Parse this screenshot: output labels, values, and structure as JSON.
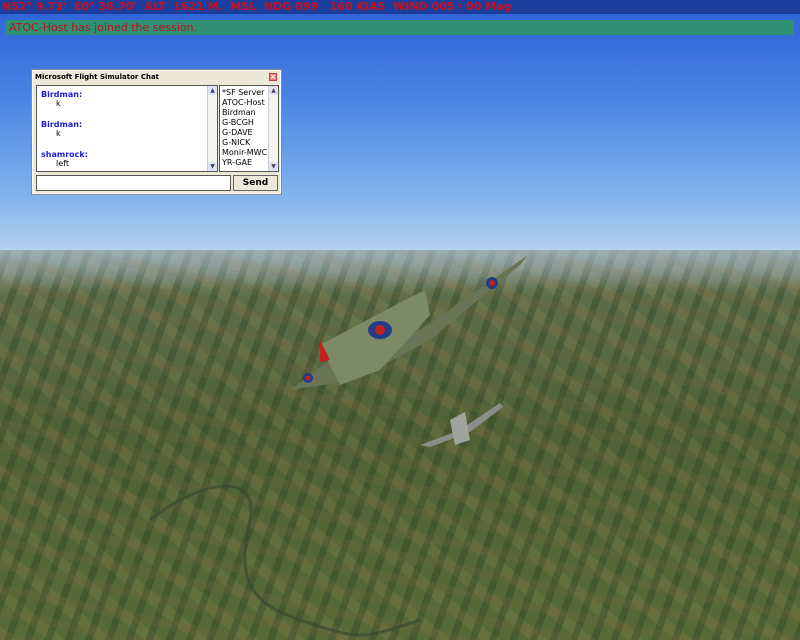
{
  "hud": {
    "text": "N52° 9.73'  E0° 38.70'  ALT  1621 M.  MSL  HDG 099   160 KIAS  WIND 005 / 00 Mag"
  },
  "notice": {
    "text": "ATOC-Host has joined the session."
  },
  "chat": {
    "title": "Microsoft Flight Simulator Chat",
    "close": "×",
    "messages": [
      {
        "sender": "Birdman:",
        "text": "k"
      },
      {
        "sender": "Birdman:",
        "text": "k"
      },
      {
        "sender": "shamrock:",
        "text": "left"
      }
    ],
    "users": [
      "*SF Server",
      "ATOC-Host",
      "Birdman",
      "G-BCGH",
      "G-DAVE",
      "G-NICK",
      "Monir-MWC",
      "YR-GAE"
    ],
    "input_value": "",
    "send_label": "Send"
  }
}
